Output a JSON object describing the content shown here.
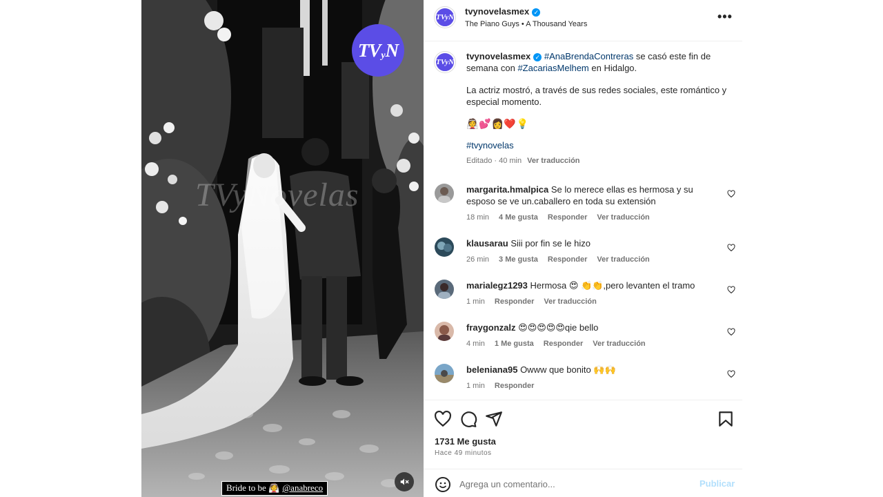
{
  "media": {
    "badge_main_left": "TV",
    "badge_small": "y",
    "badge_main_right": "N",
    "watermark": "TVyNovelas",
    "caption_tag": "Bride to be 👰",
    "caption_tag_user": "@anabreco"
  },
  "header": {
    "avatar_text": "TVyN",
    "username": "tvynovelasmex",
    "music": "The Piano Guys • A Thousand Years",
    "more_icon": "•••"
  },
  "caption": {
    "username": "tvynovelasmex",
    "hashtag1": "#AnaBrendaContreras",
    "text1": " se casó este fin de semana con ",
    "hashtag2": "#ZacariasMelhem",
    "text2": " en Hidalgo.",
    "paragraph2": "La actriz mostró, a través de sus redes sociales, este romántico y especial momento.",
    "emojis": "👰💕👩‍❤️💡",
    "hashtag3": "#tvynovelas",
    "edited": "Editado · 40 min",
    "translate": "Ver traducción"
  },
  "comments": [
    {
      "user": "margarita.hmalpica",
      "text": "Se lo merece ellas es hermosa y su esposo se ve un.caballero en toda su extensión",
      "time": "18 min",
      "likes": "4 Me gusta",
      "reply": "Responder",
      "translate": "Ver traducción"
    },
    {
      "user": "klausarau",
      "text": "Siii por fin se le hizo",
      "time": "26 min",
      "likes": "3 Me gusta",
      "reply": "Responder",
      "translate": "Ver traducción"
    },
    {
      "user": "marialegz1293",
      "text": "Hermosa 😍 👏👏,pero levanten el tramo",
      "time": "1 min",
      "reply": "Responder",
      "translate": "Ver traducción"
    },
    {
      "user": "fraygonzalz",
      "text": "😍😍😍😍😍qie bello",
      "time": "4 min",
      "likes": "1 Me gusta",
      "reply": "Responder",
      "translate": "Ver traducción"
    },
    {
      "user": "beleniana95",
      "text": "Owww que bonito 🙌🙌",
      "time": "1 min",
      "reply": "Responder"
    }
  ],
  "footer": {
    "likes": "1731 Me gusta",
    "time_ago": "Hace 49 minutos",
    "comment_placeholder": "Agrega un comentario...",
    "publish": "Publicar"
  },
  "colors": {
    "brand_purple": "#5b4de6",
    "link_blue": "#00376b",
    "verified_blue": "#0095f6",
    "muted": "#737373"
  },
  "icons": [
    "heart-icon",
    "comment-icon",
    "share-icon",
    "bookmark-icon",
    "emoji-icon",
    "mute-icon",
    "verified-icon",
    "more-icon"
  ]
}
